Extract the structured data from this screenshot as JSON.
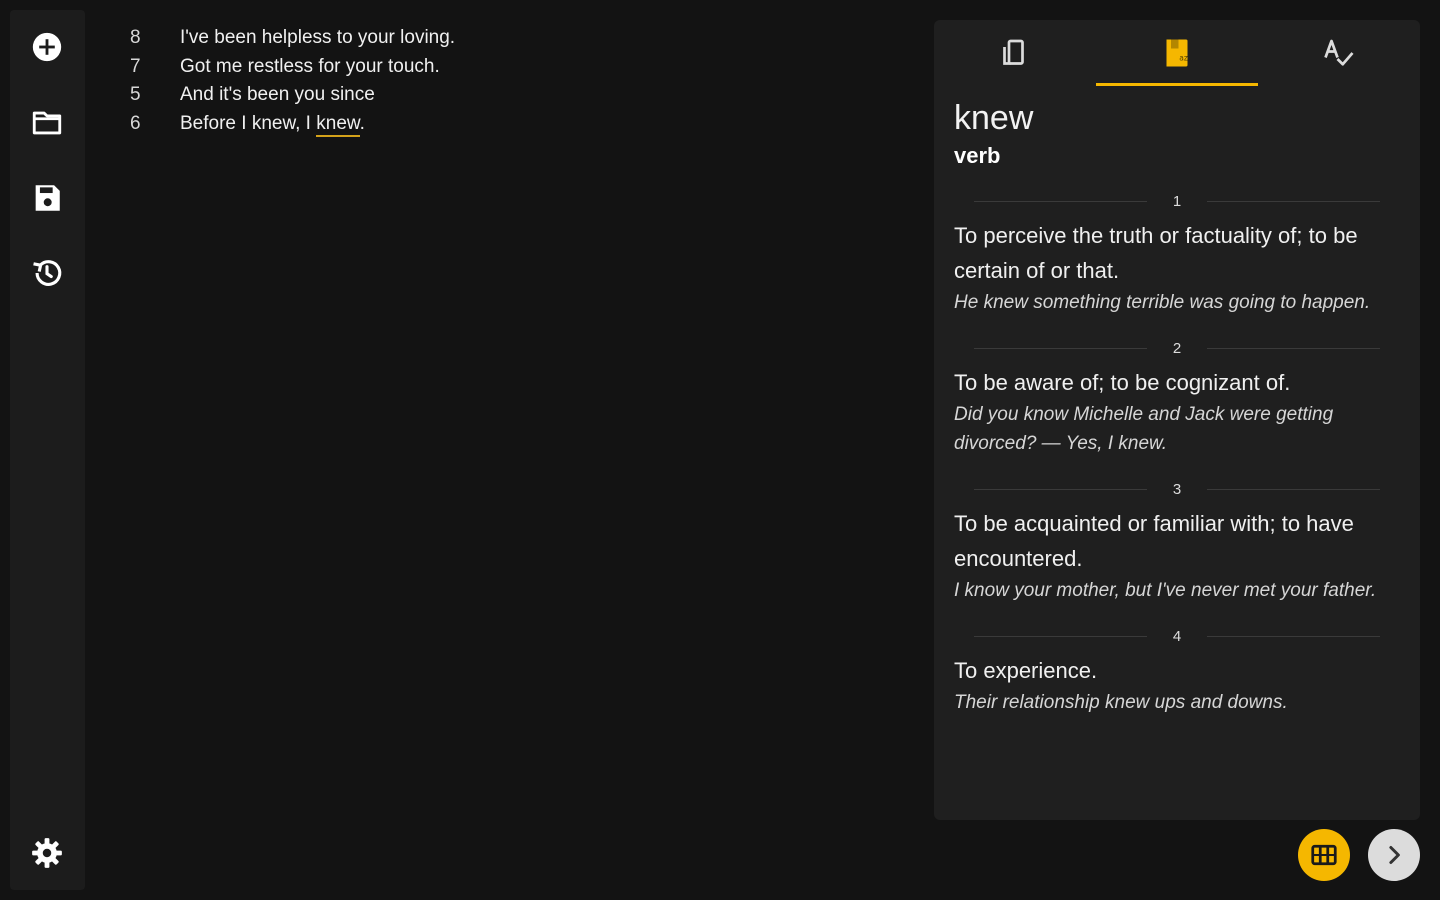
{
  "sidebar": {
    "items": [
      {
        "name": "new",
        "icon": "add-circle-icon"
      },
      {
        "name": "open",
        "icon": "folder-icon"
      },
      {
        "name": "save",
        "icon": "save-icon"
      },
      {
        "name": "history",
        "icon": "history-icon"
      }
    ],
    "settings_icon": "gear-icon"
  },
  "lyrics": [
    {
      "num": "8",
      "text": "I've been helpless to your loving."
    },
    {
      "num": "7",
      "text": "Got me restless for your touch."
    },
    {
      "num": "5",
      "text": "And it's been you since"
    },
    {
      "num": "6",
      "text_before": "Before I knew, I ",
      "text_highlight": "knew",
      "text_after": "."
    }
  ],
  "panel": {
    "tabs": [
      {
        "name": "rhymes",
        "icon": "phone-rotate-icon",
        "active": false
      },
      {
        "name": "dictionary",
        "icon": "dictionary-icon",
        "active": true
      },
      {
        "name": "spellcheck",
        "icon": "spellcheck-icon",
        "active": false
      }
    ],
    "word": "knew",
    "part_of_speech": "verb",
    "senses": [
      {
        "num": "1",
        "definition": "To perceive the truth or factuality of; to be certain of or that.",
        "example": "He knew something terrible was going to happen."
      },
      {
        "num": "2",
        "definition": "To be aware of; to be cognizant of.",
        "example": "Did you know Michelle and Jack were getting divorced? — Yes, I knew."
      },
      {
        "num": "3",
        "definition": "To be acquainted or familiar with; to have encountered.",
        "example": "I know your mother, but I've never met your father."
      },
      {
        "num": "4",
        "definition": "To experience.",
        "example": "Their relationship knew ups and downs."
      }
    ]
  },
  "fabs": {
    "primary_icon": "columns-icon",
    "secondary_icon": "chevron-right-icon"
  },
  "colors": {
    "accent": "#f5b700",
    "background": "#131313",
    "panel": "#1f1f1f",
    "rail": "#1c1c1c"
  }
}
